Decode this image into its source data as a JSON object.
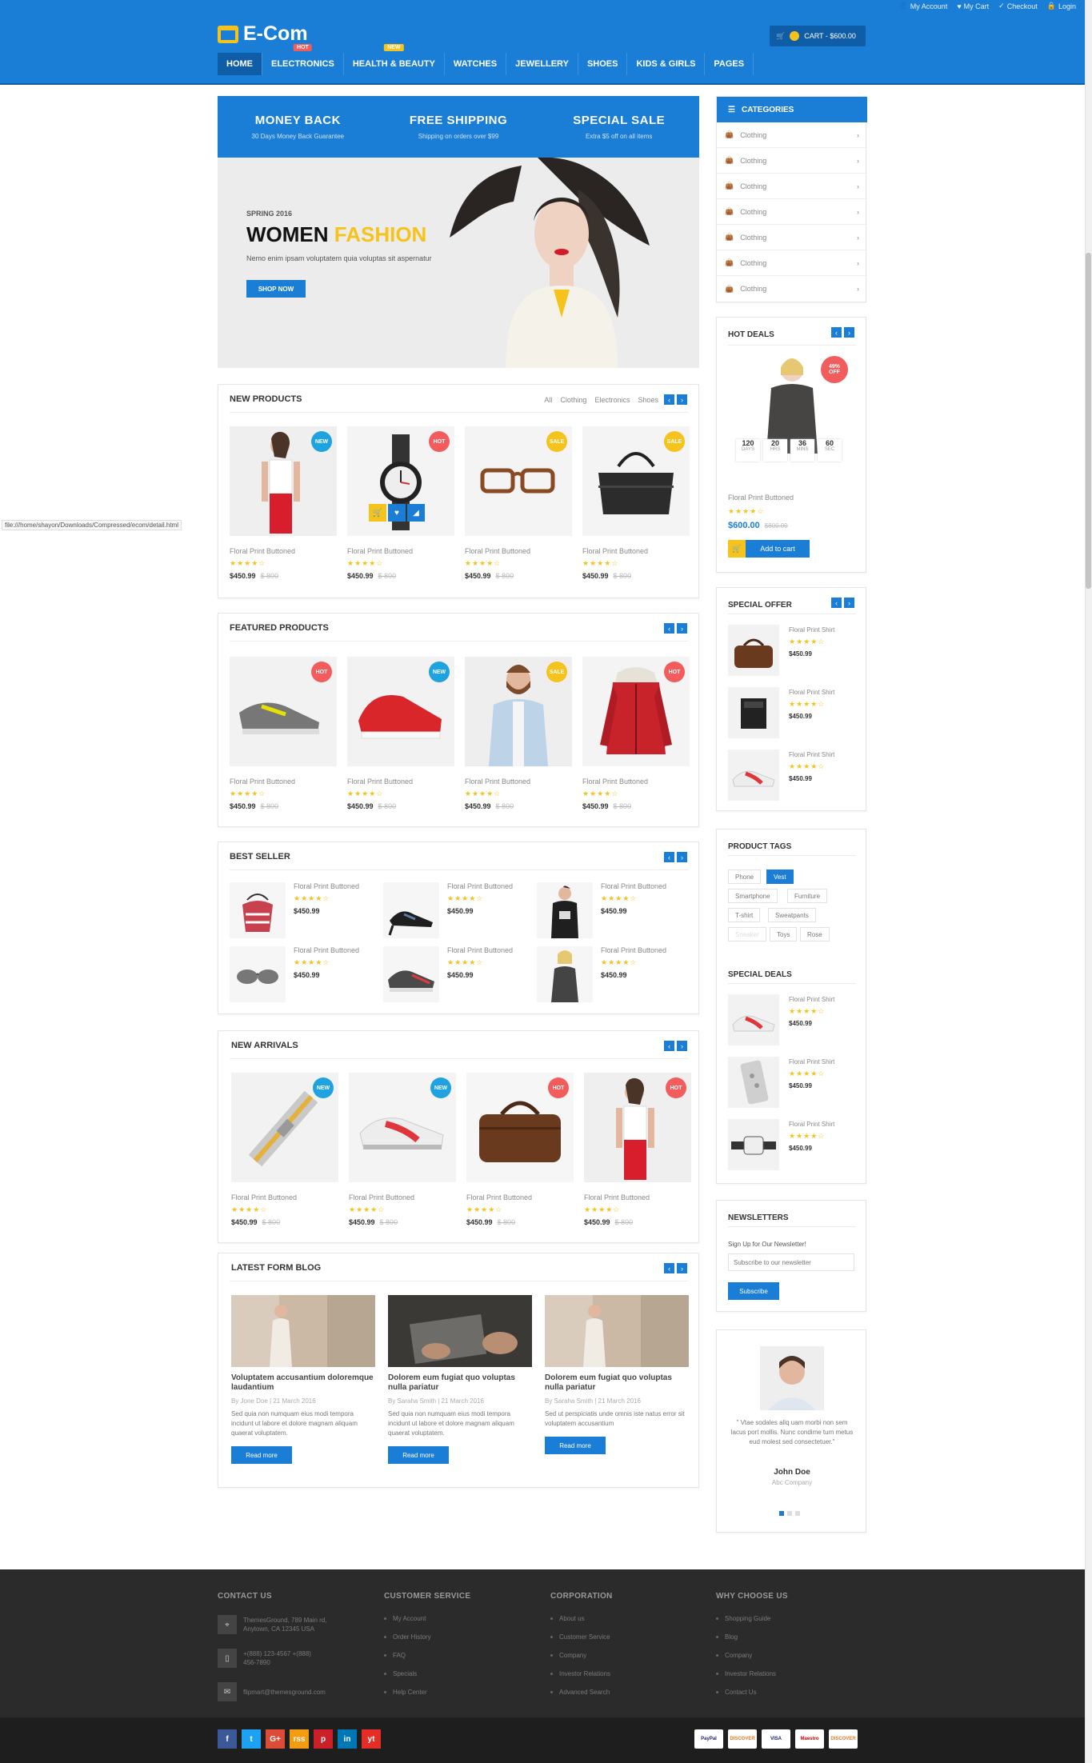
{
  "header": {
    "top_links": [
      "My Account",
      "My Cart",
      "Checkout",
      "Login"
    ],
    "logo": "E-Com",
    "cart": "CART - $600.00",
    "nav": [
      {
        "label": "HOME",
        "badge": ""
      },
      {
        "label": "ELECTRONICS",
        "badge": "HOT"
      },
      {
        "label": "HEALTH & BEAUTY",
        "badge": "NEW"
      },
      {
        "label": "WATCHES",
        "badge": ""
      },
      {
        "label": "JEWELLERY",
        "badge": ""
      },
      {
        "label": "SHOES",
        "badge": ""
      },
      {
        "label": "KIDS & GIRLS",
        "badge": ""
      },
      {
        "label": "PAGES",
        "badge": ""
      }
    ]
  },
  "banner": {
    "features": [
      {
        "title": "MONEY BACK",
        "sub": "30 Days Money Back Guarantee"
      },
      {
        "title": "FREE SHIPPING",
        "sub": "Shipping on orders over $99"
      },
      {
        "title": "SPECIAL SALE",
        "sub": "Extra $5 off on all items"
      }
    ],
    "season": "SPRING 2016",
    "headline_a": "WOMEN ",
    "headline_b": "FASHION",
    "sub": "Nemo enim ipsam voluptatem quia voluptas sit aspernatur",
    "button": "SHOP NOW"
  },
  "new_products": {
    "title": "NEW PRODUCTS",
    "tabs": [
      "All",
      "Clothing",
      "Electronics",
      "Shoes"
    ],
    "items": [
      {
        "name": "Floral Print Buttoned",
        "price": "$450.99",
        "old": "$ 800",
        "tag": "NEW"
      },
      {
        "name": "Floral Print Buttoned",
        "price": "$450.99",
        "old": "$ 800",
        "tag": "HOT"
      },
      {
        "name": "Floral Print Buttoned",
        "price": "$450.99",
        "old": "$ 800",
        "tag": "SALE"
      },
      {
        "name": "Floral Print Buttoned",
        "price": "$450.99",
        "old": "$ 800",
        "tag": "SALE"
      }
    ]
  },
  "featured": {
    "title": "FEATURED PRODUCTS",
    "items": [
      {
        "name": "Floral Print Buttoned",
        "price": "$450.99",
        "old": "$ 800",
        "tag": "HOT"
      },
      {
        "name": "Floral Print Buttoned",
        "price": "$450.99",
        "old": "$ 800",
        "tag": "NEW"
      },
      {
        "name": "Floral Print Buttoned",
        "price": "$450.99",
        "old": "$ 800",
        "tag": "SALE"
      },
      {
        "name": "Floral Print Buttoned",
        "price": "$450.99",
        "old": "$ 800",
        "tag": "HOT"
      }
    ]
  },
  "best_seller": {
    "title": "BEST SELLER",
    "item_name": "Floral Print Buttoned",
    "item_price": "$450.99"
  },
  "new_arrivals": {
    "title": "NEW ARRIVALS",
    "items": [
      {
        "name": "Floral Print Buttoned",
        "price": "$450.99",
        "old": "$ 800",
        "tag": "NEW"
      },
      {
        "name": "Floral Print Buttoned",
        "price": "$450.99",
        "old": "$ 800",
        "tag": "NEW"
      },
      {
        "name": "Floral Print Buttoned",
        "price": "$450.99",
        "old": "$ 800",
        "tag": "HOT"
      },
      {
        "name": "Floral Print Buttoned",
        "price": "$450.99",
        "old": "$ 800",
        "tag": "HOT"
      }
    ]
  },
  "blog": {
    "title": "LATEST FORM BLOG",
    "posts": [
      {
        "title": "Voluptatem accusantium doloremque laudantium",
        "meta": "By Jone Doe  |  21 March 2016",
        "text": "Sed quia non numquam eius modi tempora incidunt ut labore et dolore magnam aliquam quaerat voluptatem.",
        "button": "Read more"
      },
      {
        "title": "Dolorem eum fugiat quo voluptas nulla pariatur",
        "meta": "By Saraha Smith  |  21 March 2016",
        "text": "Sed quia non numquam eius modi tempora incidunt ut labore et dolore magnam aliquam quaerat voluptatem.",
        "button": "Read more"
      },
      {
        "title": "Dolorem eum fugiat quo voluptas nulla pariatur",
        "meta": "By Saraha Smith  |  21 March 2016",
        "text": "Sed ut perspiciatis unde omnis iste natus error sit voluptatem accusantium",
        "button": "Read more"
      }
    ]
  },
  "sidebar": {
    "categories_title": "CATEGORIES",
    "category_label": "Clothing",
    "hot_deals": {
      "title": "HOT DEALS",
      "badge_pct": "49%",
      "badge_off": "OFF",
      "timer": [
        {
          "n": "120",
          "u": "DAYS"
        },
        {
          "n": "20",
          "u": "HRS"
        },
        {
          "n": "36",
          "u": "MINS"
        },
        {
          "n": "60",
          "u": "SEC"
        }
      ],
      "name": "Floral Print Buttoned",
      "price": "$600.00",
      "old": "$800.00",
      "button": "Add to cart"
    },
    "special_offer": {
      "title": "SPECIAL OFFER",
      "item_name": "Floral Print Shirt",
      "item_price": "$450.99"
    },
    "tags": {
      "title": "PRODUCT TAGS",
      "list": [
        "Phone",
        "Vest",
        "Smartphone",
        "Furniture",
        "T-shirt",
        "Sweatpants",
        "Sneaker",
        "Toys",
        "Rose"
      ]
    },
    "special_deals": {
      "title": "SPECIAL DEALS",
      "item_name": "Floral Print Shirt",
      "item_price": "$450.99"
    },
    "newsletter": {
      "title": "NEWSLETTERS",
      "label": "Sign Up for Our Newsletter!",
      "placeholder": "Subscribe to our newsletter",
      "button": "Subscribe"
    },
    "testimonial": {
      "quote": "\" Vtae sodales aliq uam morbi non sem lacus port mollis. Nunc condime tum metus eud molest sed consectetuer.\"",
      "name": "John Doe",
      "company": "Abc Company"
    }
  },
  "footer": {
    "contact_title": "CONTACT US",
    "address": "ThemesGround, 789 Main rd, Anytown, CA 12345 USA",
    "phone": "+(888) 123-4567 +(888) 456-7890",
    "email": "flipmart@themesground.com",
    "cs_title": "CUSTOMER SERVICE",
    "cs": [
      "My Account",
      "Order History",
      "FAQ",
      "Specials",
      "Help Center"
    ],
    "corp_title": "CORPORATION",
    "corp": [
      "About us",
      "Customer Service",
      "Company",
      "Investor Relations",
      "Advanced Search"
    ],
    "why_title": "WHY CHOOSE US",
    "why": [
      "Shopping Guide",
      "Blog",
      "Company",
      "Investor Relations",
      "Contact Us"
    ],
    "social": [
      "f",
      "t",
      "G+",
      "rss",
      "p",
      "in",
      "yt"
    ],
    "payments": [
      "PayPal",
      "DISCOVER",
      "VISA",
      "Maestro",
      "DISCOVER"
    ]
  },
  "status_url": "file:///home/shayon/Downloads/Compressed/ecom/detail.html",
  "colors": {
    "primary": "#1b7ed6",
    "accent": "#f6c31c",
    "hot": "#f25c5c",
    "new": "#1fa3e0"
  }
}
